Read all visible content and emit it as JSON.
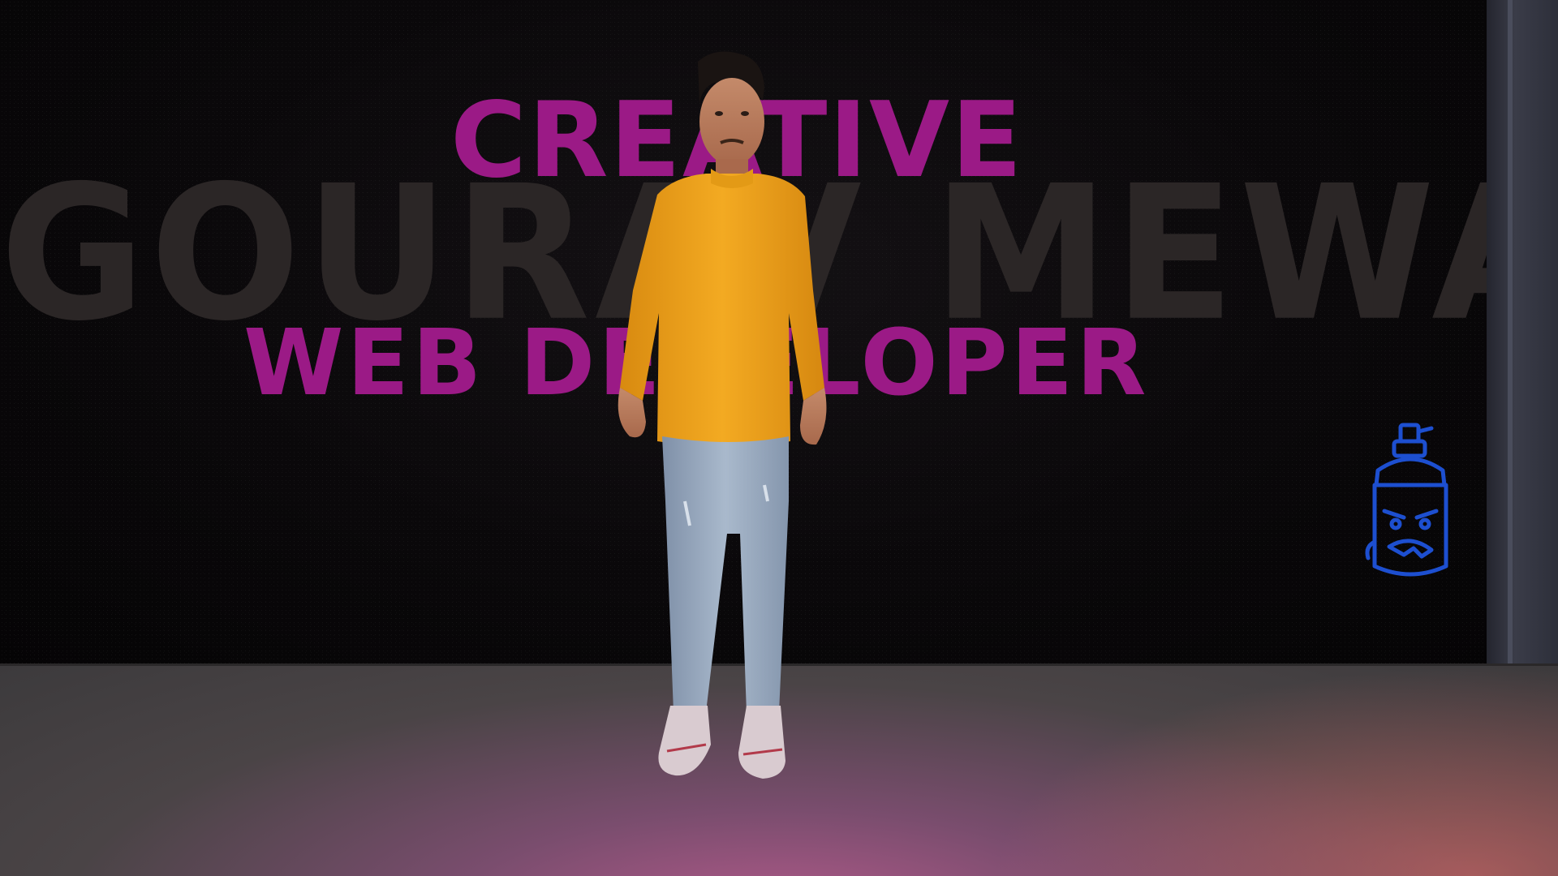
{
  "wall": {
    "headline": "CREATIVE",
    "name": "GOURAV MEWADA",
    "role": "WEB DEVELOPER"
  },
  "colors": {
    "headline": "#9b1a86",
    "name": "#2b2626",
    "sweater": "#f0a61a",
    "jeans": "#9fb0c4",
    "floor_glow": "#b25a8a",
    "graffiti": "#1d4fd0"
  },
  "icons": {
    "graffiti": "spray-can-icon"
  }
}
